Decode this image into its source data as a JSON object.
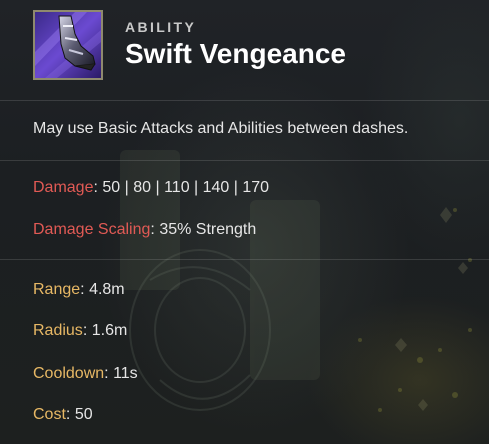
{
  "ability": {
    "type": "ABILITY",
    "name": "Swift Vengeance",
    "icon": "armored-boot-icon",
    "description": "May use Basic Attacks and Abilities between dashes."
  },
  "damage_stats": [
    {
      "label": "Damage",
      "value": "50 | 80 | 110 | 140 | 170"
    },
    {
      "label": "Damage Scaling",
      "value": "35% Strength"
    }
  ],
  "utility_stats": [
    {
      "label": "Range",
      "value": "4.8m"
    },
    {
      "label": "Radius",
      "value": "1.6m"
    },
    {
      "label": "Cooldown",
      "value": "11s"
    },
    {
      "label": "Cost",
      "value": "50"
    }
  ],
  "colors": {
    "damage_label": "#e15a55",
    "utility_label": "#e7b865",
    "title": "#ffffff",
    "body_text": "#e6e6e6"
  },
  "separator": ":"
}
